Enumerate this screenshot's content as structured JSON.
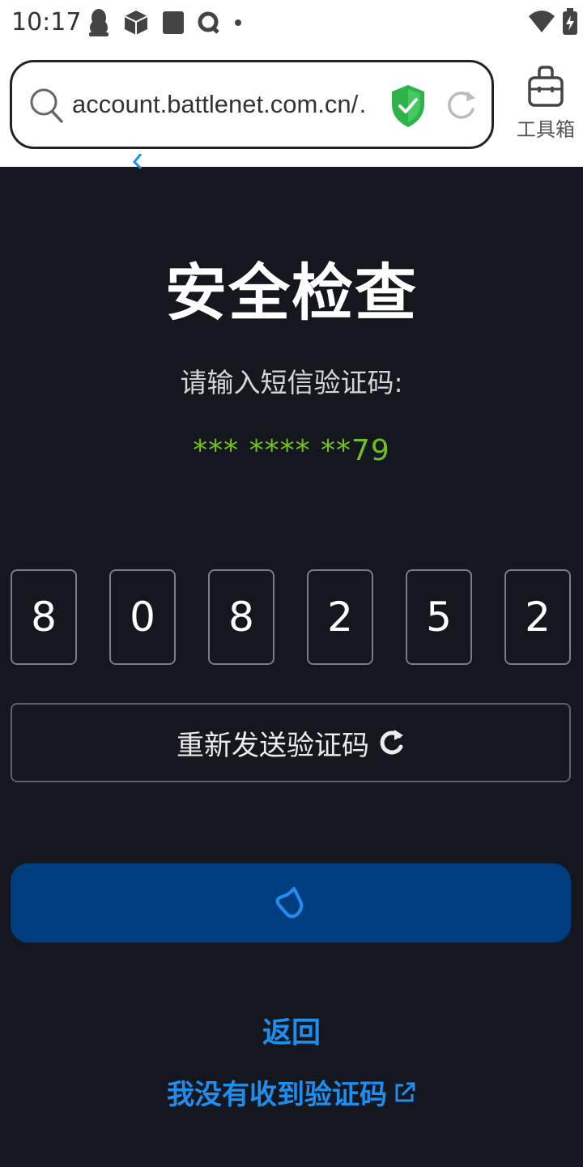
{
  "status_bar": {
    "time": "10:17",
    "icons": [
      "qq-penguin-icon",
      "cube-icon",
      "square-app-icon",
      "q-app-icon",
      "dot-icon"
    ],
    "right_icons": [
      "wifi-icon",
      "battery-icon"
    ]
  },
  "browser": {
    "url": "account.battlenet.com.cn/…",
    "toolbox_label": "工具箱"
  },
  "colors": {
    "background": "#15171f",
    "accent_blue": "#1e8ef0",
    "button_blue": "#003d7e",
    "phone_green": "#6ec11f"
  },
  "main": {
    "title": "安全检查",
    "subtitle": "请输入短信验证码:",
    "phone_masked": "*** **** **79",
    "otp_digits": [
      "8",
      "0",
      "8",
      "2",
      "5",
      "2"
    ],
    "resend_label": "重新发送验证码",
    "back_label": "返回",
    "no_code_label": "我没有收到验证码"
  }
}
